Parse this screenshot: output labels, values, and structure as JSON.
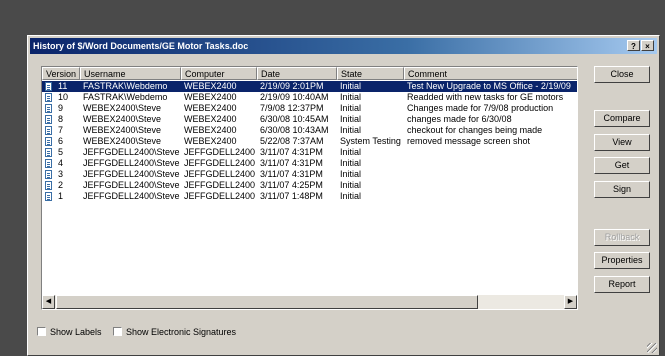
{
  "window": {
    "title": "History of $/Word Documents/GE Motor Tasks.doc",
    "help_label": "?",
    "close_label": "×"
  },
  "columns": [
    "Version",
    "Username",
    "Computer",
    "Date",
    "State",
    "Comment"
  ],
  "rows": [
    {
      "version": "11",
      "username": "FASTRAK\\Webdemo",
      "computer": "WEBEX2400",
      "date": "2/19/09 2:01PM",
      "state": "Initial",
      "comment": "Test New Upgrade to MS Office - 2/19/09",
      "selected": true
    },
    {
      "version": "10",
      "username": "FASTRAK\\Webdemo",
      "computer": "WEBEX2400",
      "date": "2/19/09 10:40AM",
      "state": "Initial",
      "comment": "Readded with new tasks for GE motors"
    },
    {
      "version": "9",
      "username": "WEBEX2400\\Steve",
      "computer": "WEBEX2400",
      "date": "7/9/08 12:37PM",
      "state": "Initial",
      "comment": "Changes made for 7/9/08 production"
    },
    {
      "version": "8",
      "username": "WEBEX2400\\Steve",
      "computer": "WEBEX2400",
      "date": "6/30/08 10:45AM",
      "state": "Initial",
      "comment": "changes made for 6/30/08"
    },
    {
      "version": "7",
      "username": "WEBEX2400\\Steve",
      "computer": "WEBEX2400",
      "date": "6/30/08 10:43AM",
      "state": "Initial",
      "comment": "checkout for changes being made"
    },
    {
      "version": "6",
      "username": "WEBEX2400\\Steve",
      "computer": "WEBEX2400",
      "date": "5/22/08 7:37AM",
      "state": "System Testing",
      "comment": "removed message screen shot"
    },
    {
      "version": "5",
      "username": "JEFFGDELL2400\\Steve",
      "computer": "JEFFGDELL2400",
      "date": "3/11/07 4:31PM",
      "state": "Initial",
      "comment": ""
    },
    {
      "version": "4",
      "username": "JEFFGDELL2400\\Steve",
      "computer": "JEFFGDELL2400",
      "date": "3/11/07 4:31PM",
      "state": "Initial",
      "comment": ""
    },
    {
      "version": "3",
      "username": "JEFFGDELL2400\\Steve",
      "computer": "JEFFGDELL2400",
      "date": "3/11/07 4:31PM",
      "state": "Initial",
      "comment": ""
    },
    {
      "version": "2",
      "username": "JEFFGDELL2400\\Steve",
      "computer": "JEFFGDELL2400",
      "date": "3/11/07 4:25PM",
      "state": "Initial",
      "comment": ""
    },
    {
      "version": "1",
      "username": "JEFFGDELL2400\\Steve",
      "computer": "JEFFGDELL2400",
      "date": "3/11/07 1:48PM",
      "state": "Initial",
      "comment": ""
    }
  ],
  "buttons": {
    "close": "Close",
    "compare": "Compare",
    "view": "View",
    "get": "Get",
    "sign": "Sign",
    "rollback": "Rollback",
    "properties": "Properties",
    "report": "Report"
  },
  "checkboxes": {
    "show_labels": "Show Labels",
    "show_signatures": "Show Electronic Signatures"
  },
  "colors": {
    "selection": "#0a246a",
    "title_bar": "#0a246a",
    "dialog_face": "#d4d0c8"
  }
}
